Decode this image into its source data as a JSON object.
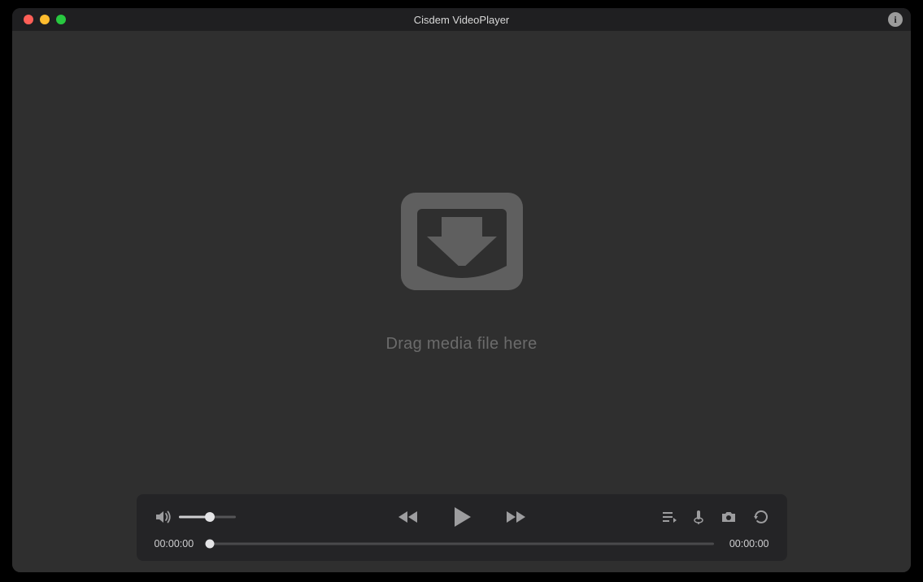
{
  "titlebar": {
    "title": "Cisdem VideoPlayer"
  },
  "dropzone": {
    "label": "Drag media file here"
  },
  "controls": {
    "volume_percent": 55,
    "elapsed": "00:00:00",
    "total": "00:00:00",
    "progress_percent": 0
  }
}
